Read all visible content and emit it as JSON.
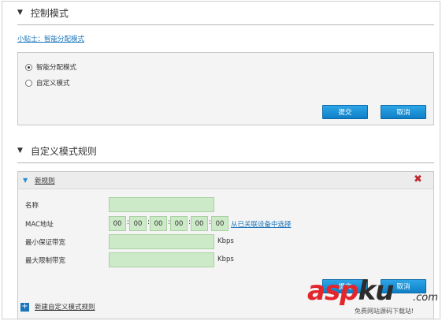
{
  "control_section": {
    "title": "控制模式",
    "tip_link": "小贴士：智能分配模式",
    "options": [
      {
        "label": "智能分配模式",
        "selected": true
      },
      {
        "label": "自定义模式",
        "selected": false
      }
    ],
    "submit_label": "提交",
    "cancel_label": "取消"
  },
  "custom_section": {
    "title": "自定义模式规则",
    "rule": {
      "title": "新规则",
      "name_label": "名称",
      "name_value": "",
      "mac_label": "MAC地址",
      "mac_octets": [
        "00",
        "00",
        "00",
        "00",
        "00",
        "00"
      ],
      "select_device_link": "从已关联设备中选择",
      "min_bw_label": "最小保证带宽",
      "min_bw_value": "",
      "max_bw_label": "最大限制带宽",
      "max_bw_value": "",
      "unit": "Kbps",
      "submit_label": "提交",
      "cancel_label": "取消"
    },
    "add_rule_label": "新建自定义模式规则"
  },
  "watermark": {
    "brand_a": "asp",
    "brand_b": "ku",
    "suffix": ".com",
    "sub": "免费网站源码下载站!"
  },
  "colors": {
    "accent": "#1a75bc",
    "button": "#1a8ad4",
    "field_bg": "#cdeac8",
    "close": "#c0272d"
  }
}
